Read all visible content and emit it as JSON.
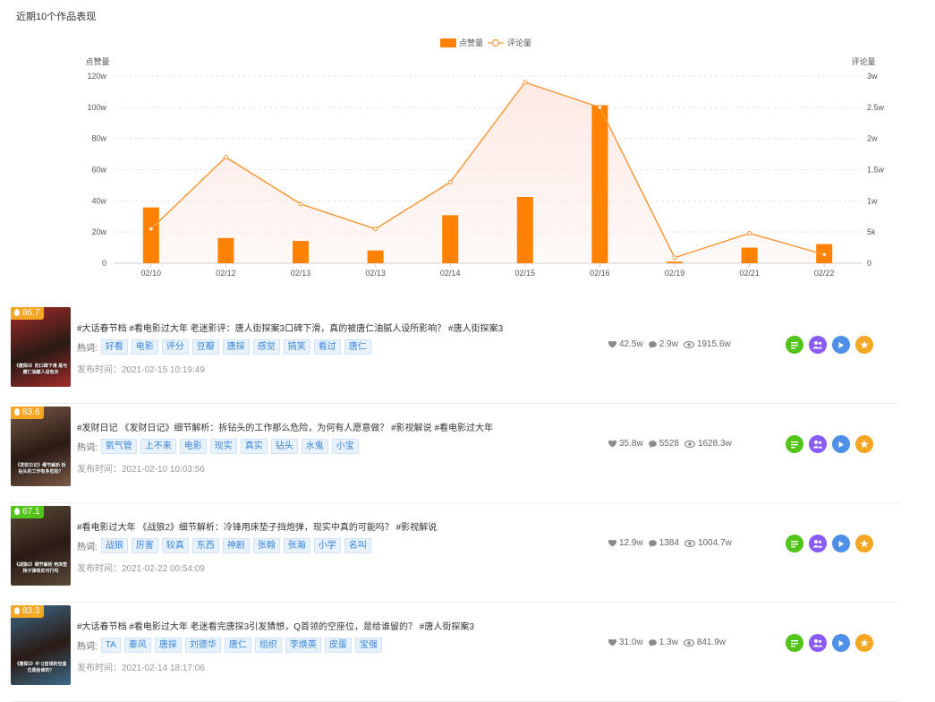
{
  "section_title": "近期10个作品表现",
  "colors": {
    "bar": "#ff8205",
    "line": "#f59a3c",
    "area": "#fde8e2",
    "tag_text": "#3a86d8",
    "act_green": "#52c41a",
    "act_purple": "#8a5cf6",
    "act_blue": "#4e8fe8",
    "act_orange": "#f5a623"
  },
  "chart_data": {
    "type": "bar",
    "legend": [
      "点赞量",
      "评论量"
    ],
    "legend_position": "top-center",
    "y_left_label": "点赞量",
    "y_right_label": "评论量",
    "y_left_ticks": [
      "0",
      "20w",
      "40w",
      "60w",
      "80w",
      "100w",
      "120w"
    ],
    "y_right_ticks": [
      "0",
      "5k",
      "1w",
      "1.5w",
      "2w",
      "2.5w",
      "3w"
    ],
    "ylim_left": [
      0,
      120
    ],
    "ylim_right": [
      0,
      3
    ],
    "categories": [
      "02/10",
      "02/12",
      "02/13",
      "02/13",
      "02/14",
      "02/15",
      "02/16",
      "02/19",
      "02/21",
      "02/22"
    ],
    "series": [
      {
        "name": "点赞量",
        "type": "bar",
        "axis": "left",
        "unit": "w",
        "values": [
          35.8,
          16.2,
          14.3,
          8.2,
          30.8,
          42.5,
          101.4,
          1.0,
          10.0,
          12.3
        ]
      },
      {
        "name": "评论量",
        "type": "line",
        "axis": "right",
        "unit": "w",
        "values": [
          0.55,
          1.7,
          0.95,
          0.55,
          1.3,
          2.9,
          2.5,
          0.09,
          0.48,
          0.14
        ]
      }
    ],
    "grid": true
  },
  "videos": [
    {
      "score": "86.7",
      "score_color": "#f5a623",
      "thumb_bg": "#a32b2b",
      "thumb_text": "《唐探3》的口碑下滑 是与唐仁油腻人设有关",
      "title": "#大话春节档 #看电影过大年 老迷影评：唐人街探案3口碑下滑，真的被唐仁油腻人设所影响？ #唐人街探案3",
      "hot_label": "热词:",
      "tags": [
        "好看",
        "电影",
        "评分",
        "豆瓣",
        "唐探",
        "感觉",
        "搞笑",
        "看过",
        "唐仁"
      ],
      "publish": "发布时间：2021-02-15 10:19:49",
      "likes": "42.5w",
      "comments": "2.9w",
      "views": "1915.6w"
    },
    {
      "score": "83.6",
      "score_color": "#f5a623",
      "thumb_bg": "#7a5a48",
      "thumb_text": "《发财日记》细节解析 拆钻头的工作有多危险？",
      "title": "#发财日记 《发财日记》细节解析：拆钻头的工作那么危险，为何有人愿意做？ #影视解说 #看电影过大年",
      "hot_label": "热词:",
      "tags": [
        "氧气管",
        "上不来",
        "电影",
        "现实",
        "真实",
        "钻头",
        "水鬼",
        "小宝"
      ],
      "publish": "发布时间：2021-02-10 10:03:56",
      "likes": "35.8w",
      "comments": "5528",
      "views": "1628.3w"
    },
    {
      "score": "67.1",
      "score_color": "#52c41a",
      "thumb_bg": "#5a4a3a",
      "thumb_text": "《战狼2》细节解析 用床垫挡子弹现实可行吗",
      "title": "#看电影过大年 《战狼2》细节解析：冷锋用床垫子挡炮弹，现实中真的可能吗？ #影视解说",
      "hot_label": "热词:",
      "tags": [
        "战狼",
        "厉害",
        "较真",
        "东西",
        "神剧",
        "张翰",
        "张瀚",
        "小学",
        "名叫"
      ],
      "publish": "发布时间：2021-02-22 00:54:09",
      "likes": "12.9w",
      "comments": "1384",
      "views": "1004.7w"
    },
    {
      "score": "83.3",
      "score_color": "#f5a623",
      "thumb_bg": "#3c6a8a",
      "thumb_text": "《唐探3》中 Q首领的空座位是给谁的？",
      "title": "#大话春节档 #看电影过大年 老迷看完唐探3引发猜想，Q首领的空座位，是给谁留的？ #唐人街探案3",
      "hot_label": "热词:",
      "tags": [
        "TA",
        "秦风",
        "唐探",
        "刘德华",
        "唐仁",
        "组织",
        "李焕英",
        "皮蛋",
        "宝强"
      ],
      "publish": "发布时间：2021-02-14 18:17:06",
      "likes": "31.0w",
      "comments": "1.3w",
      "views": "841.9w"
    }
  ]
}
